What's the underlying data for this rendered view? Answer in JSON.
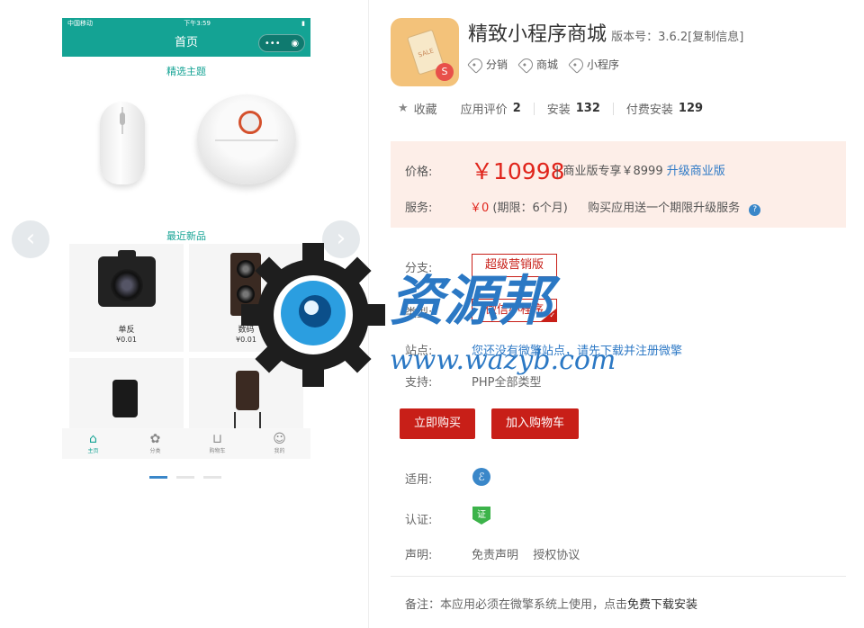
{
  "phone": {
    "carrier": "中国移动",
    "time": "下午3:59",
    "nav_title": "首页",
    "section_featured": "精选主题",
    "section_new": "最近新品",
    "products": [
      {
        "name": "单反",
        "price": "¥0.01"
      },
      {
        "name": "数码",
        "price": "¥0.01"
      },
      {
        "name": "",
        "price": ""
      },
      {
        "name": "",
        "price": ""
      }
    ],
    "tabs": [
      {
        "label": "主页",
        "icon": "home-icon"
      },
      {
        "label": "分类",
        "icon": "category-icon"
      },
      {
        "label": "购物车",
        "icon": "cart-icon"
      },
      {
        "label": "我的",
        "icon": "user-icon"
      }
    ]
  },
  "product": {
    "title": "精致小程序商城",
    "version": "版本号：3.6.2[复制信息]",
    "tags": [
      "分销",
      "商城",
      "小程序"
    ],
    "favorite_label": "收藏",
    "rating_label": "应用评价",
    "rating_count": "2",
    "install_label": "安装",
    "install_count": "132",
    "paid_install_label": "付费安装",
    "paid_install_count": "129"
  },
  "pricing": {
    "price_label": "价格:",
    "price": "￥10998",
    "business_prefix": "| 商业版专享￥8999",
    "upgrade_link": "升级商业版",
    "service_label": "服务:",
    "service_price": "￥0",
    "service_period": "(期限：6个月)",
    "service_note": "购买应用送一个期限升级服务"
  },
  "options": {
    "branch_label": "分支:",
    "branch_value": "超级营销版",
    "type_label": "类型:",
    "type_value": "微信小程序",
    "site_label": "站点:",
    "site_text": "您还没有微擎站点，请先下载并注册微擎",
    "support_label": "支持:",
    "support_value": "PHP全部类型"
  },
  "actions": {
    "buy_now": "立即购买",
    "add_cart": "加入购物车"
  },
  "meta": {
    "applicable_label": "适用:",
    "cert_label": "认证:",
    "statement_label": "声明:",
    "disclaimer": "免责声明",
    "license": "授权协议",
    "note_prefix": "备注：本应用必须在微擎系统上使用，点击",
    "note_link": "免费下载安装"
  },
  "watermark": {
    "chars": "资源邦",
    "url": "www.wazyb.com"
  },
  "colors": {
    "theme": "#14a394",
    "brand_red": "#c81f18",
    "price_red": "#e0251c",
    "link_blue": "#2f7ac6",
    "price_bg": "#fdeee8"
  }
}
